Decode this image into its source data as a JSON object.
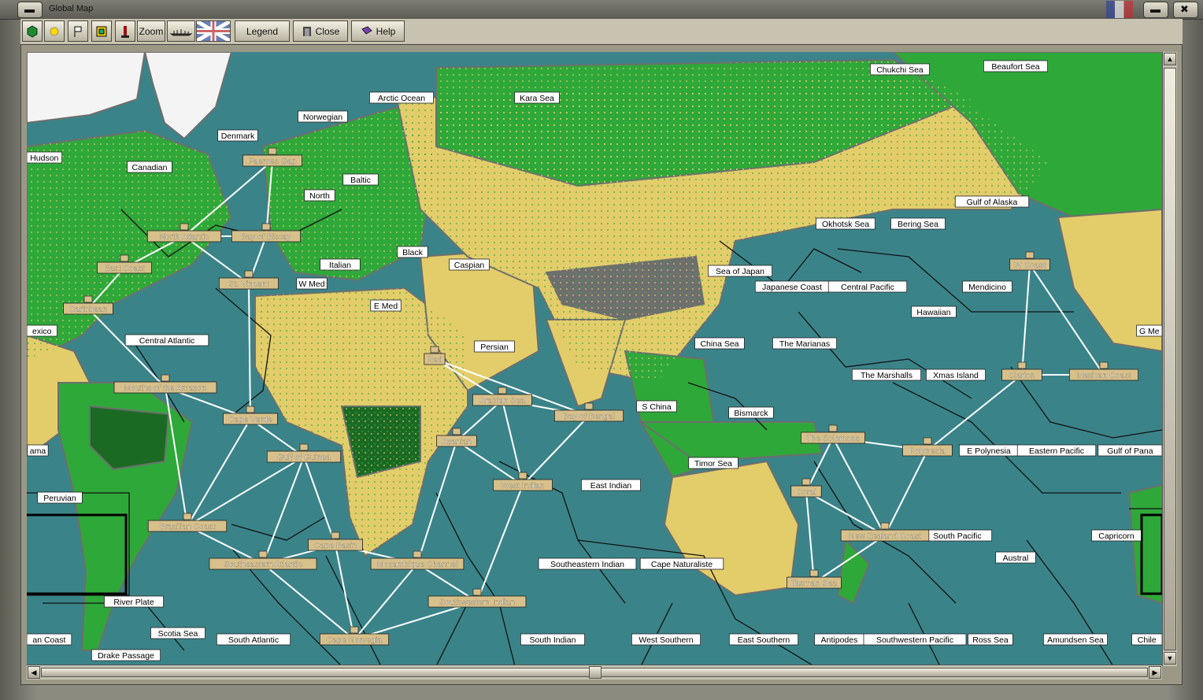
{
  "window": {
    "title": "Global Map"
  },
  "toolbar": {
    "zoom_label": "Zoom",
    "legend_label": "Legend",
    "close_label": "Close",
    "help_label": "Help",
    "icons": [
      "green-hexagon-icon",
      "sun-icon",
      "flag-icon",
      "square-icon",
      "lighthouse-icon",
      "ships-icon",
      "union-jack-icon"
    ]
  },
  "colors": {
    "ocean": "#3a8489",
    "land_yellow": "#e3cd6a",
    "land_green": "#2fa83a",
    "land_dark_green": "#1b6a24",
    "mountain": "#6e6e6e",
    "snow": "#f4f4f4",
    "border": "#111111",
    "route": "#ffffff",
    "white_label_bg": "#ffffff",
    "tan_label_bg": "#d7c08a"
  },
  "labels_white": [
    "Chukchi Sea",
    "Beaufort Sea",
    "Arctic Ocean",
    "Kara Sea",
    "Norwegian",
    "Denmark",
    "Hudson",
    "Canadian",
    "Baltic",
    "North",
    "Black",
    "Caspian",
    "Italian",
    "W Med",
    "E Med",
    "Persian",
    "Gulf of Alaska",
    "Okhotsk Sea",
    "Bering Sea",
    "Sea of Japan",
    "Japanese Coast",
    "Central Pacific",
    "Mendicino",
    "Hawaiian",
    "The Marianas",
    "China Sea",
    "The Marshalls",
    "Xmas Island",
    "S China",
    "Bismarck",
    "E Polynesia",
    "Eastern Pacific",
    "Gulf of Pana",
    "G Me",
    "exico",
    "Central Atlantic",
    "ama",
    "Peruvian",
    "East Indian",
    "Timor Sea",
    "Southeastern Indian",
    "Cape Naturaliste",
    "South Pacific",
    "Austral",
    "Capricorn",
    "River Plate",
    "Scotia Sea",
    "an Coast",
    "Drake Passage",
    "South Atlantic",
    "South Indian",
    "West Southern",
    "East Southern",
    "Antipodes",
    "Southwestern Pacific",
    "Ross Sea",
    "Amundsen Sea",
    "Chile"
  ],
  "labels_tan": [
    "Faeroes Gap",
    "North Atlantic",
    "Bay of Biscay",
    "East Coast",
    "St. Vincent",
    "Caribbean",
    "Mouths of the Amazon",
    "Cape Verde",
    "Gulf of Guinea",
    "Brazilian Coast",
    "Southeastern Atlantic",
    "Cape Basin",
    "Mozambique Channel",
    "Cape Norvegia",
    "Southwestern Indian",
    "Red",
    "Arabian Sea",
    "Bay of Bengal",
    "Azanian",
    "West Indian",
    "W Coast",
    "Clarion",
    "Mexican Coast",
    "The Solomons",
    "Polynesia",
    "Coral",
    "New Zealand Coast",
    "Tasman Sea"
  ],
  "routes": [
    [
      "Faeroes Gap",
      "North Atlantic"
    ],
    [
      "Faeroes Gap",
      "Bay of Biscay"
    ],
    [
      "North Atlantic",
      "Bay of Biscay"
    ],
    [
      "North Atlantic",
      "St. Vincent"
    ],
    [
      "Bay of Biscay",
      "St. Vincent"
    ],
    [
      "North Atlantic",
      "East Coast"
    ],
    [
      "East Coast",
      "Caribbean"
    ],
    [
      "Caribbean",
      "Mouths of the Amazon"
    ],
    [
      "St. Vincent",
      "Cape Verde"
    ],
    [
      "Mouths of the Amazon",
      "Cape Verde"
    ],
    [
      "Mouths of the Amazon",
      "Brazilian Coast"
    ],
    [
      "Cape Verde",
      "Gulf of Guinea"
    ],
    [
      "Gulf of Guinea",
      "Brazilian Coast"
    ],
    [
      "Gulf of Guinea",
      "Southeastern Atlantic"
    ],
    [
      "Gulf of Guinea",
      "Cape Basin"
    ],
    [
      "Cape Verde",
      "Brazilian Coast"
    ],
    [
      "Brazilian Coast",
      "Southeastern Atlantic"
    ],
    [
      "Southeastern Atlantic",
      "Cape Basin"
    ],
    [
      "Cape Basin",
      "Mozambique Channel"
    ],
    [
      "Southeastern Atlantic",
      "Cape Norvegia"
    ],
    [
      "Cape Basin",
      "Cape Norvegia"
    ],
    [
      "Mozambique Channel",
      "Cape Norvegia"
    ],
    [
      "Cape Norvegia",
      "Southwestern Indian"
    ],
    [
      "Mozambique Channel",
      "Southwestern Indian"
    ],
    [
      "Mozambique Channel",
      "Azanian"
    ],
    [
      "Azanian",
      "Arabian Sea"
    ],
    [
      "Azanian",
      "West Indian"
    ],
    [
      "Red",
      "Arabian Sea"
    ],
    [
      "Red",
      "Bay of Bengal"
    ],
    [
      "Arabian Sea",
      "Bay of Bengal"
    ],
    [
      "Arabian Sea",
      "West Indian"
    ],
    [
      "Bay of Bengal",
      "West Indian"
    ],
    [
      "West Indian",
      "Southwestern Indian"
    ],
    [
      "W Coast",
      "Clarion"
    ],
    [
      "W Coast",
      "Mexican Coast"
    ],
    [
      "Clarion",
      "Mexican Coast"
    ],
    [
      "Clarion",
      "Polynesia"
    ],
    [
      "The Solomons",
      "Polynesia"
    ],
    [
      "The Solomons",
      "Coral"
    ],
    [
      "The Solomons",
      "New Zealand Coast"
    ],
    [
      "Polynesia",
      "New Zealand Coast"
    ],
    [
      "Coral",
      "New Zealand Coast"
    ],
    [
      "Coral",
      "Tasman Sea"
    ],
    [
      "Tasman Sea",
      "New Zealand Coast"
    ]
  ]
}
